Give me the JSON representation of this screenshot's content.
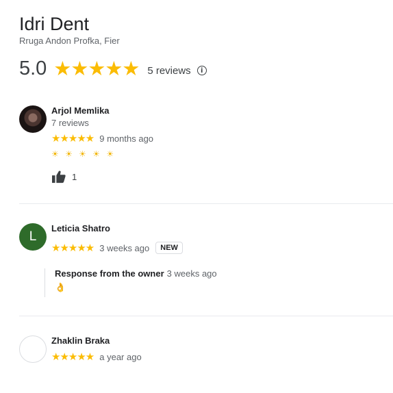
{
  "place": {
    "title": "Idri Dent",
    "address": "Rruga Andon Profka, Fier",
    "rating": "5.0",
    "stars": "★★★★★",
    "review_count": "5 reviews",
    "info_glyph": "i"
  },
  "reviews": [
    {
      "name": "Arjol Memlika",
      "meta": "7 reviews",
      "stars": "★★★★★",
      "date": "9 months ago",
      "text": "☀ ☀ ☀ ☀ ☀",
      "likes": "1",
      "avatar": "photo"
    },
    {
      "name": "Leticia Shatro",
      "avatar_letter": "L",
      "stars": "★★★★★",
      "date": "3 weeks ago",
      "badge": "NEW",
      "owner_response": {
        "label": "Response from the owner",
        "date": "3 weeks ago",
        "text": "👌"
      }
    },
    {
      "name": "Zhaklin Braka",
      "stars": "★★★★★",
      "date": "a year ago",
      "avatar": "empty"
    }
  ],
  "colors": {
    "star": "#fbbc04",
    "avatar_green": "#2e6b2a",
    "divider": "#e8eaed"
  },
  "icons": {
    "info": "info-icon",
    "like": "thumbs-up-icon"
  }
}
